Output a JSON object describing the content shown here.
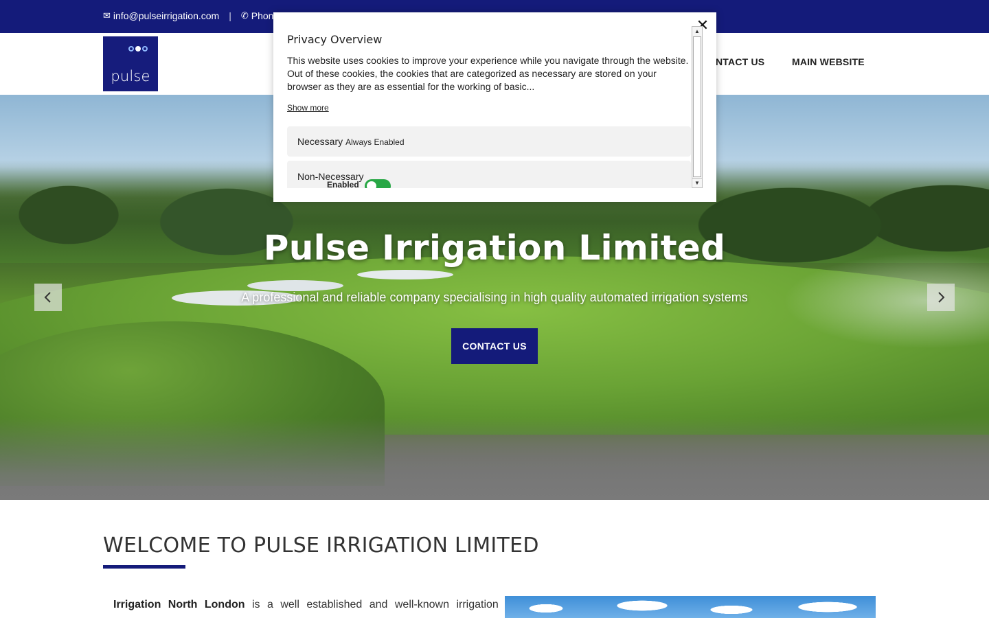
{
  "topbar": {
    "email": "info@pulseirrigation.com",
    "separator": "|",
    "phone_label": "Phon",
    "email_icon": "envelope-icon",
    "phone_icon": "phone-icon"
  },
  "header": {
    "logo_text": "pulse",
    "nav": [
      {
        "label": "NTACT US"
      },
      {
        "label": "MAIN WEBSITE"
      }
    ]
  },
  "hero": {
    "title": "Pulse Irrigation Limited",
    "subtitle": "A professional and reliable company specialising in high quality automated irrigation systems",
    "cta_label": "CONTACT US",
    "prev_icon": "chevron-left-icon",
    "next_icon": "chevron-right-icon"
  },
  "welcome": {
    "title": "WELCOME TO PULSE IRRIGATION LIMITED",
    "intro_bold": "Irrigation North London",
    "intro_rest": " is a well established and well-known irrigation"
  },
  "privacy": {
    "title": "Privacy Overview",
    "body": "This website uses cookies to improve your experience while you navigate through the website. Out of these cookies, the cookies that are categorized as necessary are stored on your browser as they are as essential for the working of basic...",
    "show_more": "Show more",
    "close_icon": "close-icon",
    "necessary_label": "Necessary",
    "necessary_status": "Always Enabled",
    "non_necessary_label": "Non-Necessary",
    "non_necessary_status": "Enabled",
    "toggle_on": true
  },
  "colors": {
    "brand": "#141b7a",
    "toggle": "#28a745"
  }
}
